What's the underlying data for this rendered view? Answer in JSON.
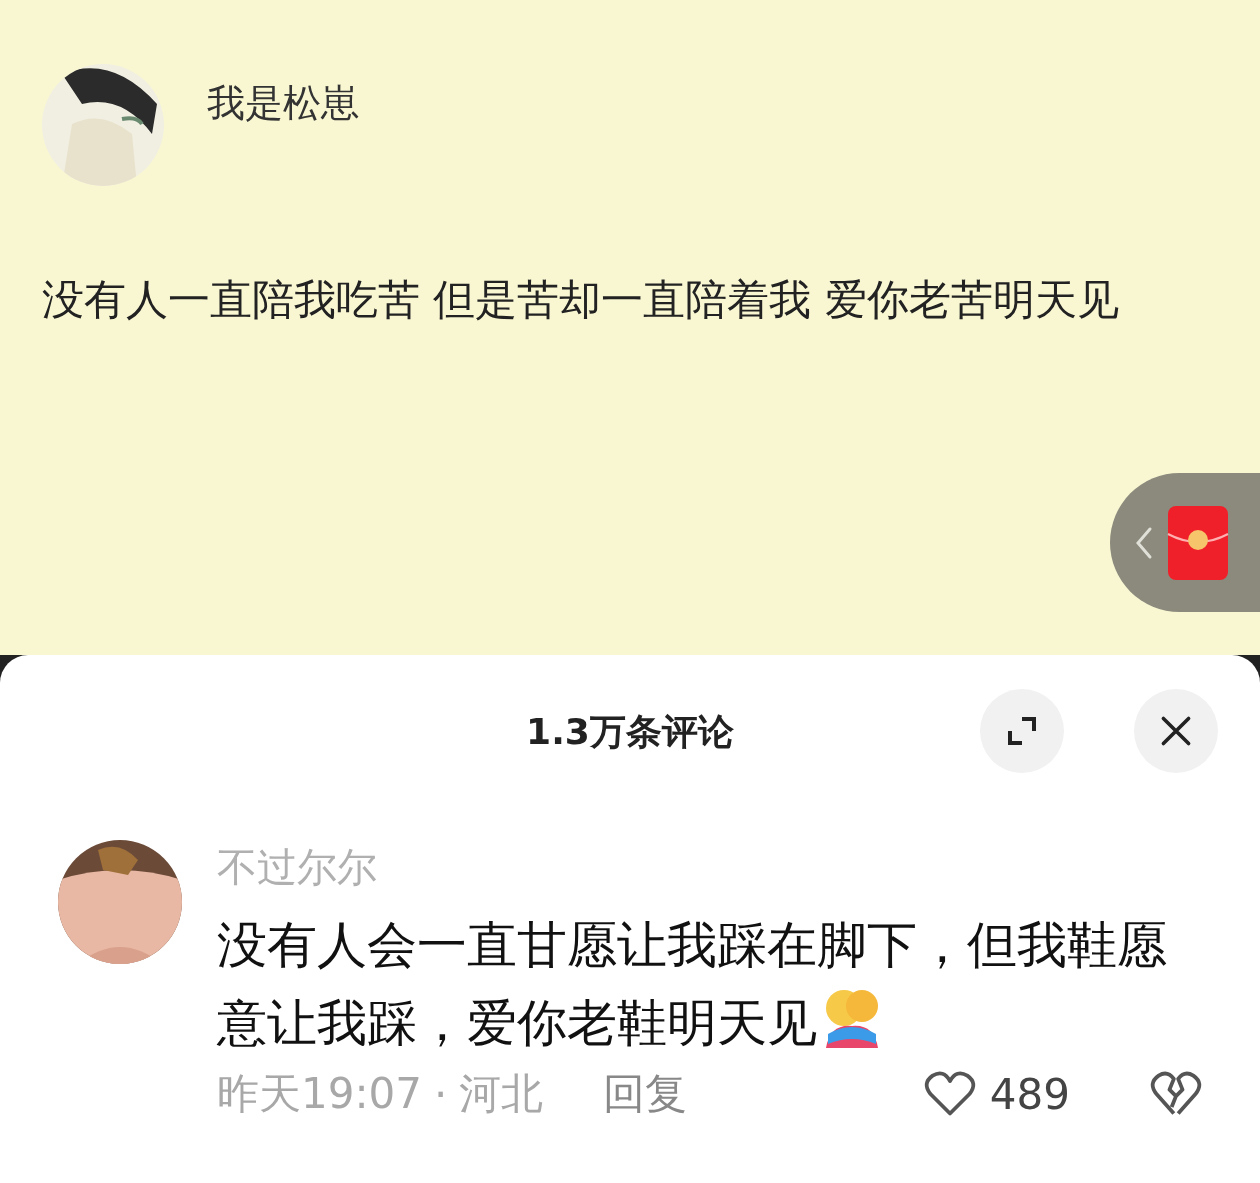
{
  "post": {
    "author": "我是松崽",
    "text": "没有人一直陪我吃苦 但是苦却一直陪着我 爱你老苦明天见"
  },
  "comments_panel": {
    "title": "1.3万条评论"
  },
  "comments": [
    {
      "username": "不过尔尔",
      "text": "没有人会一直甘愿让我踩在脚下，但我鞋愿意让我踩，爱你老鞋明天见",
      "time": "昨天19:07",
      "separator": "·",
      "location": "河北",
      "reply": "回复",
      "likes": "489"
    }
  ]
}
